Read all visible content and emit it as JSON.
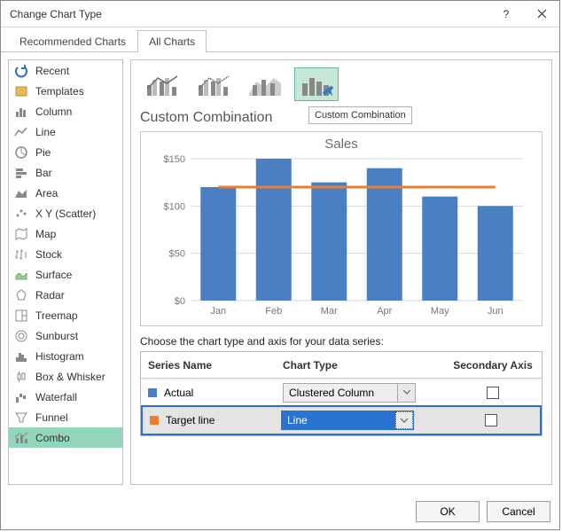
{
  "window": {
    "title": "Change Chart Type"
  },
  "tabs": {
    "recommended": "Recommended Charts",
    "all": "All Charts"
  },
  "sidebar": {
    "items": [
      {
        "label": "Recent"
      },
      {
        "label": "Templates"
      },
      {
        "label": "Column"
      },
      {
        "label": "Line"
      },
      {
        "label": "Pie"
      },
      {
        "label": "Bar"
      },
      {
        "label": "Area"
      },
      {
        "label": "X Y (Scatter)"
      },
      {
        "label": "Map"
      },
      {
        "label": "Stock"
      },
      {
        "label": "Surface"
      },
      {
        "label": "Radar"
      },
      {
        "label": "Treemap"
      },
      {
        "label": "Sunburst"
      },
      {
        "label": "Histogram"
      },
      {
        "label": "Box & Whisker"
      },
      {
        "label": "Waterfall"
      },
      {
        "label": "Funnel"
      },
      {
        "label": "Combo"
      }
    ]
  },
  "subtype_title": "Custom Combination",
  "tooltip": "Custom Combination",
  "series_prompt": "Choose the chart type and axis for your data series:",
  "series_headers": {
    "name": "Series Name",
    "type": "Chart Type",
    "axis": "Secondary Axis"
  },
  "series_rows": [
    {
      "name": "Actual",
      "type": "Clustered Column"
    },
    {
      "name": "Target line",
      "type": "Line"
    }
  ],
  "buttons": {
    "ok": "OK",
    "cancel": "Cancel"
  },
  "chart_data": {
    "type": "combo",
    "title": "Sales",
    "categories": [
      "Jan",
      "Feb",
      "Mar",
      "Apr",
      "May",
      "Jun"
    ],
    "yticks": [
      "$0",
      "$50",
      "$100",
      "$150"
    ],
    "ylim": [
      0,
      150
    ],
    "series": [
      {
        "name": "Actual",
        "type": "bar",
        "values": [
          120,
          150,
          125,
          140,
          110,
          100
        ]
      },
      {
        "name": "Target line",
        "type": "line",
        "values": [
          120,
          120,
          120,
          120,
          120,
          120
        ]
      }
    ]
  }
}
